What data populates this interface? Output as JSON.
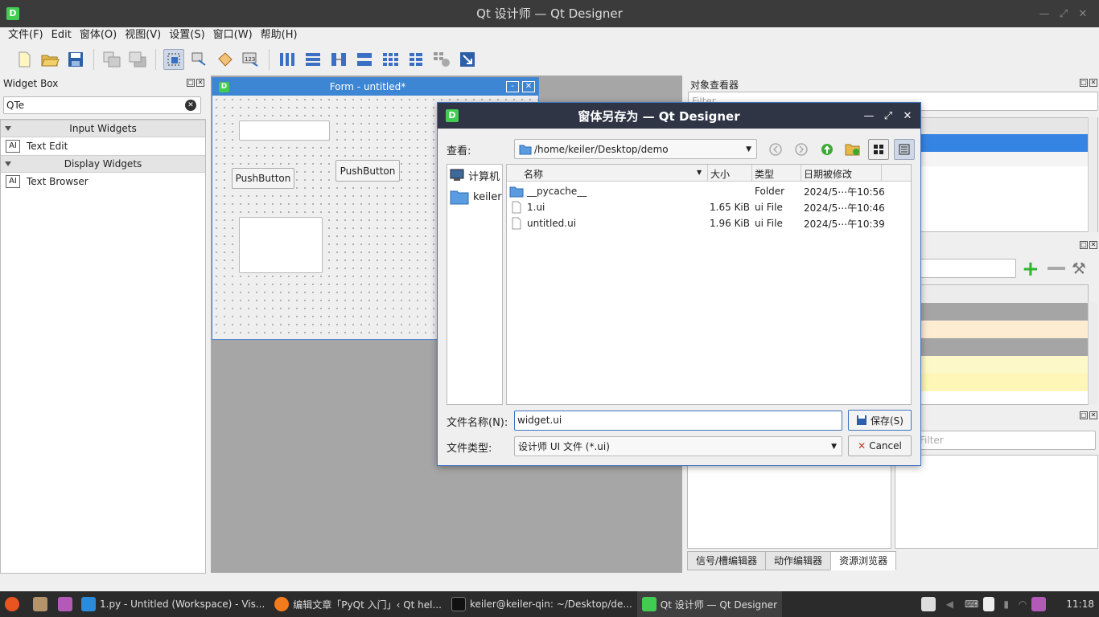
{
  "window": {
    "title": "Qt 设计师 — Qt Designer",
    "logo": "D"
  },
  "menu": {
    "items": [
      "文件(F)",
      "Edit",
      "窗体(O)",
      "视图(V)",
      "设置(S)",
      "窗口(W)",
      "帮助(H)"
    ]
  },
  "widget_box": {
    "title": "Widget Box",
    "search_value": "QTe",
    "categories": [
      {
        "label": "Input Widgets",
        "items": [
          "Text Edit"
        ]
      },
      {
        "label": "Display Widgets",
        "items": [
          "Text Browser"
        ]
      }
    ],
    "icon_glyph": "AI"
  },
  "form": {
    "title": "Form - untitled*",
    "button1": "PushButton",
    "button2": "PushButton",
    "min_glyph": "-",
    "close_glyph": "✕"
  },
  "object_inspector": {
    "title": "对象查看器",
    "filter_placeholder": "Filter"
  },
  "right_filter": {
    "placeholder": "Filter"
  },
  "bottom_tabs": [
    "信号/槽编辑器",
    "动作编辑器",
    "资源浏览器"
  ],
  "dialog": {
    "title": "窗体另存为 — Qt Designer",
    "look_in_label": "查看:",
    "path": "/home/keiler/Desktop/demo",
    "sidebar": [
      "计算机",
      "keiler"
    ],
    "headers": {
      "name": "名称",
      "size": "大小",
      "type": "类型",
      "date": "日期被修改"
    },
    "files": [
      {
        "name": "__pycache__",
        "size": "",
        "type": "Folder",
        "date": "2024/5⋯午10:56",
        "kind": "folder"
      },
      {
        "name": "1.ui",
        "size": "1.65 KiB",
        "type": "ui File",
        "date": "2024/5⋯午10:46",
        "kind": "file"
      },
      {
        "name": "untitled.ui",
        "size": "1.96 KiB",
        "type": "ui File",
        "date": "2024/5⋯午10:39",
        "kind": "file"
      }
    ],
    "filename_label": "文件名称(N):",
    "filename_value": "widget.ui",
    "filetype_label": "文件类型:",
    "filetype_value": "设计师 UI 文件 (*.ui)",
    "save_label": "保存(S)",
    "cancel_label": "Cancel"
  },
  "taskbar": {
    "tasks": [
      "1.py - Untitled (Workspace) - Vis...",
      "编辑文章「PyQt 入门」‹ Qt hel...",
      "keiler@keiler-qin: ~/Desktop/de...",
      "Qt 设计师 — Qt Designer"
    ],
    "clock": "11:18"
  }
}
